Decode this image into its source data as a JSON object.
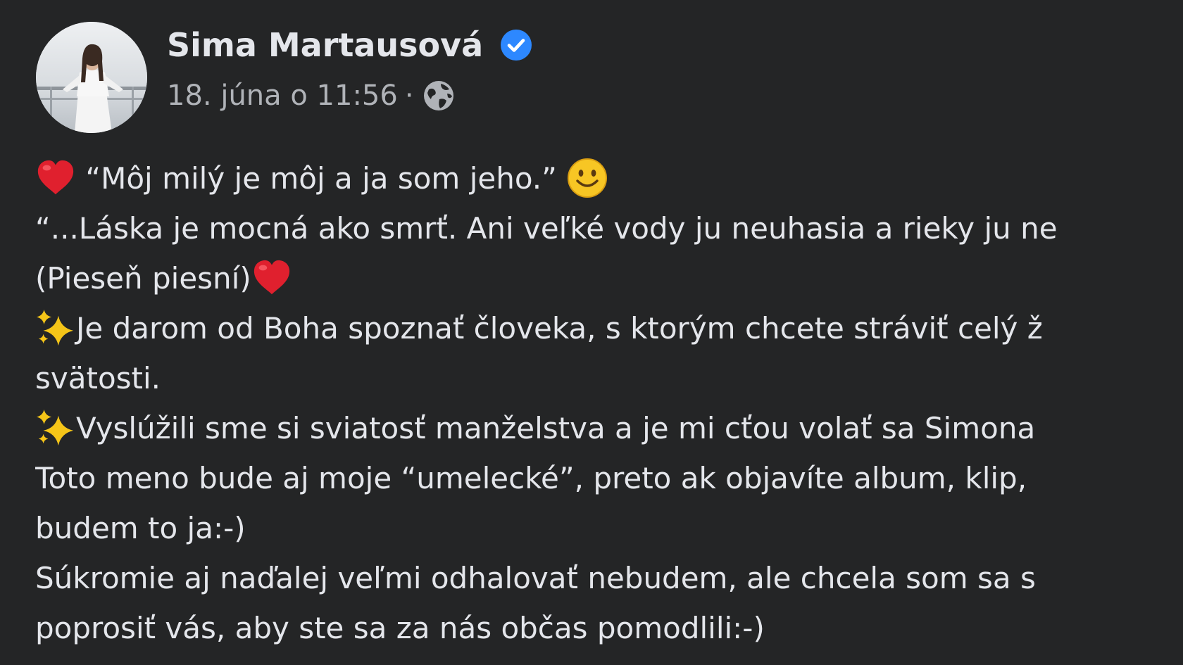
{
  "post": {
    "author": "Sima Martausová",
    "timestamp": "18. júna o 11:56",
    "separator": "·",
    "audience_icon": "globe-icon",
    "verified_icon": "verified-badge-icon",
    "lines": [
      {
        "pre": "",
        "lead_emoji": "red-heart-icon",
        "text": " “Môj milý je môj a ja som jeho.” ",
        "trail_emoji": "smile-icon"
      },
      {
        "text": "“...Láska je mocná ako smrť. Ani veľké vody ju neuhasia a rieky ju ne"
      },
      {
        "text": "(Pieseň piesní)",
        "trail_emoji": "red-heart-icon"
      },
      {
        "lead_emoji": "sparkles-icon",
        "text": "Je darom od Boha spoznať človeka, s ktorým chcete stráviť celý ž"
      },
      {
        "text": "svätosti."
      },
      {
        "lead_emoji": "sparkles-icon",
        "text": "Vyslúžili sme si sviatosť manželstva a je mi cťou volať sa Simona"
      },
      {
        "text": "Toto meno bude aj moje “umelecké”, preto ak objavíte album, klip,"
      },
      {
        "text": "budem to ja:-)"
      },
      {
        "text": "Súkromie aj naďalej veľmi odhalovať nebudem, ale chcela som sa s"
      },
      {
        "text": "poprosiť vás, aby ste sa za nás občas pomodlili:-)"
      }
    ]
  },
  "colors": {
    "background": "#242526",
    "text_primary": "#e4e6eb",
    "text_secondary": "#b0b3b8",
    "verified_blue": "#2d88ff",
    "heart_red": "#e0202e",
    "smile_yellow": "#f7c624",
    "sparkle_gold": "#f5c518"
  }
}
